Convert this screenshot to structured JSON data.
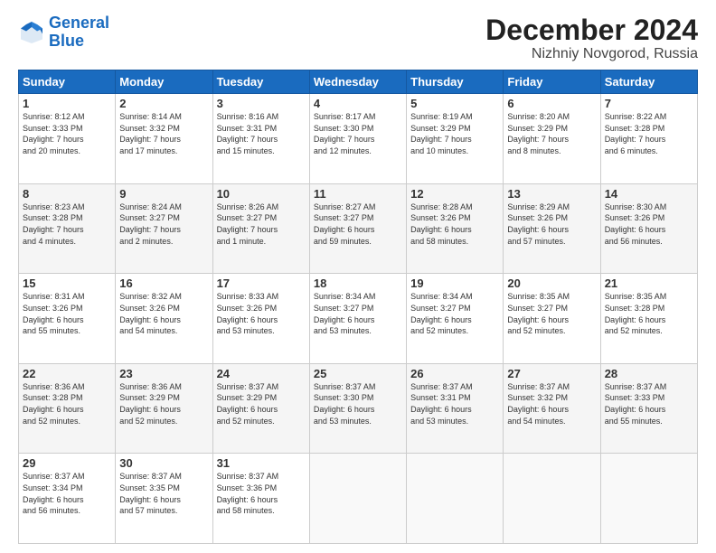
{
  "logo": {
    "line1": "General",
    "line2": "Blue"
  },
  "title": "December 2024",
  "subtitle": "Nizhniy Novgorod, Russia",
  "days_of_week": [
    "Sunday",
    "Monday",
    "Tuesday",
    "Wednesday",
    "Thursday",
    "Friday",
    "Saturday"
  ],
  "weeks": [
    [
      {
        "day": "1",
        "info": "Sunrise: 8:12 AM\nSunset: 3:33 PM\nDaylight: 7 hours\nand 20 minutes."
      },
      {
        "day": "2",
        "info": "Sunrise: 8:14 AM\nSunset: 3:32 PM\nDaylight: 7 hours\nand 17 minutes."
      },
      {
        "day": "3",
        "info": "Sunrise: 8:16 AM\nSunset: 3:31 PM\nDaylight: 7 hours\nand 15 minutes."
      },
      {
        "day": "4",
        "info": "Sunrise: 8:17 AM\nSunset: 3:30 PM\nDaylight: 7 hours\nand 12 minutes."
      },
      {
        "day": "5",
        "info": "Sunrise: 8:19 AM\nSunset: 3:29 PM\nDaylight: 7 hours\nand 10 minutes."
      },
      {
        "day": "6",
        "info": "Sunrise: 8:20 AM\nSunset: 3:29 PM\nDaylight: 7 hours\nand 8 minutes."
      },
      {
        "day": "7",
        "info": "Sunrise: 8:22 AM\nSunset: 3:28 PM\nDaylight: 7 hours\nand 6 minutes."
      }
    ],
    [
      {
        "day": "8",
        "info": "Sunrise: 8:23 AM\nSunset: 3:28 PM\nDaylight: 7 hours\nand 4 minutes."
      },
      {
        "day": "9",
        "info": "Sunrise: 8:24 AM\nSunset: 3:27 PM\nDaylight: 7 hours\nand 2 minutes."
      },
      {
        "day": "10",
        "info": "Sunrise: 8:26 AM\nSunset: 3:27 PM\nDaylight: 7 hours\nand 1 minute."
      },
      {
        "day": "11",
        "info": "Sunrise: 8:27 AM\nSunset: 3:27 PM\nDaylight: 6 hours\nand 59 minutes."
      },
      {
        "day": "12",
        "info": "Sunrise: 8:28 AM\nSunset: 3:26 PM\nDaylight: 6 hours\nand 58 minutes."
      },
      {
        "day": "13",
        "info": "Sunrise: 8:29 AM\nSunset: 3:26 PM\nDaylight: 6 hours\nand 57 minutes."
      },
      {
        "day": "14",
        "info": "Sunrise: 8:30 AM\nSunset: 3:26 PM\nDaylight: 6 hours\nand 56 minutes."
      }
    ],
    [
      {
        "day": "15",
        "info": "Sunrise: 8:31 AM\nSunset: 3:26 PM\nDaylight: 6 hours\nand 55 minutes."
      },
      {
        "day": "16",
        "info": "Sunrise: 8:32 AM\nSunset: 3:26 PM\nDaylight: 6 hours\nand 54 minutes."
      },
      {
        "day": "17",
        "info": "Sunrise: 8:33 AM\nSunset: 3:26 PM\nDaylight: 6 hours\nand 53 minutes."
      },
      {
        "day": "18",
        "info": "Sunrise: 8:34 AM\nSunset: 3:27 PM\nDaylight: 6 hours\nand 53 minutes."
      },
      {
        "day": "19",
        "info": "Sunrise: 8:34 AM\nSunset: 3:27 PM\nDaylight: 6 hours\nand 52 minutes."
      },
      {
        "day": "20",
        "info": "Sunrise: 8:35 AM\nSunset: 3:27 PM\nDaylight: 6 hours\nand 52 minutes."
      },
      {
        "day": "21",
        "info": "Sunrise: 8:35 AM\nSunset: 3:28 PM\nDaylight: 6 hours\nand 52 minutes."
      }
    ],
    [
      {
        "day": "22",
        "info": "Sunrise: 8:36 AM\nSunset: 3:28 PM\nDaylight: 6 hours\nand 52 minutes."
      },
      {
        "day": "23",
        "info": "Sunrise: 8:36 AM\nSunset: 3:29 PM\nDaylight: 6 hours\nand 52 minutes."
      },
      {
        "day": "24",
        "info": "Sunrise: 8:37 AM\nSunset: 3:29 PM\nDaylight: 6 hours\nand 52 minutes."
      },
      {
        "day": "25",
        "info": "Sunrise: 8:37 AM\nSunset: 3:30 PM\nDaylight: 6 hours\nand 53 minutes."
      },
      {
        "day": "26",
        "info": "Sunrise: 8:37 AM\nSunset: 3:31 PM\nDaylight: 6 hours\nand 53 minutes."
      },
      {
        "day": "27",
        "info": "Sunrise: 8:37 AM\nSunset: 3:32 PM\nDaylight: 6 hours\nand 54 minutes."
      },
      {
        "day": "28",
        "info": "Sunrise: 8:37 AM\nSunset: 3:33 PM\nDaylight: 6 hours\nand 55 minutes."
      }
    ],
    [
      {
        "day": "29",
        "info": "Sunrise: 8:37 AM\nSunset: 3:34 PM\nDaylight: 6 hours\nand 56 minutes."
      },
      {
        "day": "30",
        "info": "Sunrise: 8:37 AM\nSunset: 3:35 PM\nDaylight: 6 hours\nand 57 minutes."
      },
      {
        "day": "31",
        "info": "Sunrise: 8:37 AM\nSunset: 3:36 PM\nDaylight: 6 hours\nand 58 minutes."
      },
      null,
      null,
      null,
      null
    ]
  ]
}
